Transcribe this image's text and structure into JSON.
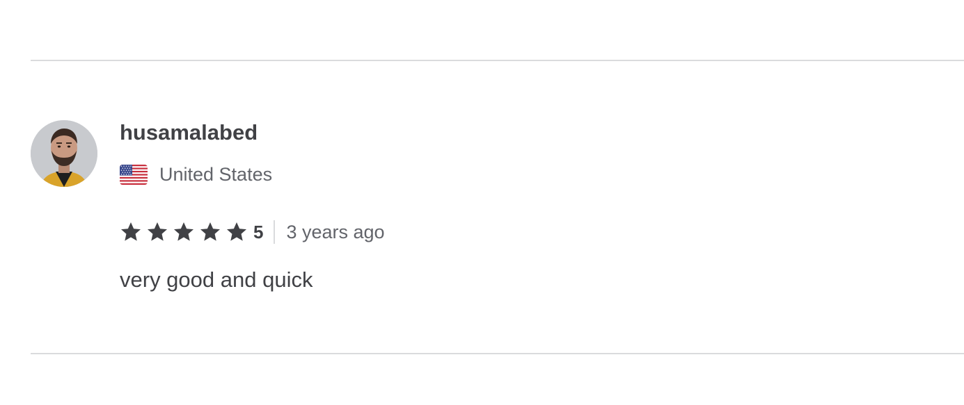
{
  "review": {
    "username": "husamalabed",
    "country": "United States",
    "country_flag_icon": "us-flag-icon",
    "avatar_icon": "user-photo",
    "rating": "5",
    "stars_filled": 5,
    "stars_total": 5,
    "time_ago": "3 years ago",
    "text": "very good and quick"
  },
  "colors": {
    "text_primary": "#404145",
    "text_secondary": "#62646a",
    "star": "#404145",
    "divider": "#dadbdd"
  }
}
